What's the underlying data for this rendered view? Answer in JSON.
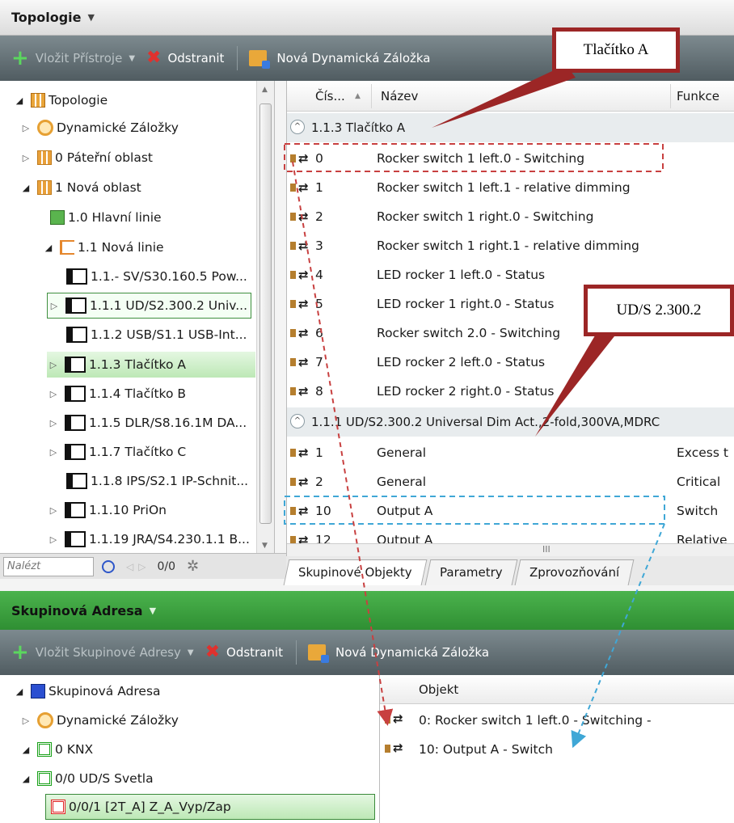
{
  "topology_panel": {
    "title": "Topologie",
    "toolbar": {
      "insert_devices": "Vložit Přístroje",
      "remove": "Odstranit",
      "new_dynamic_tab": "Nová Dynamická Záložka"
    },
    "tree": [
      {
        "label": "Topologie",
        "icon": "topology-icon",
        "expander": "open"
      },
      {
        "label": "Dynamické Záložky",
        "icon": "dynamic-folder-icon",
        "expander": "closed"
      },
      {
        "label": "0 Páteřní oblast",
        "icon": "area-icon",
        "expander": "closed"
      },
      {
        "label": "1 Nová oblast",
        "icon": "area-icon",
        "expander": "open"
      },
      {
        "label": "1.0 Hlavní linie",
        "icon": "main-line-icon",
        "expander": "none"
      },
      {
        "label": "1.1 Nová linie",
        "icon": "line-icon",
        "expander": "open"
      },
      {
        "label": "1.1.- SV/S30.160.5 Pow...",
        "icon": "device-icon",
        "expander": "none"
      },
      {
        "label": "1.1.1 UD/S2.300.2 Univ...",
        "icon": "device-icon",
        "expander": "closed"
      },
      {
        "label": "1.1.2 USB/S1.1 USB-Int...",
        "icon": "device-icon",
        "expander": "none"
      },
      {
        "label": "1.1.3 Tlačítko A",
        "icon": "device-icon",
        "expander": "closed"
      },
      {
        "label": "1.1.4 Tlačítko B",
        "icon": "device-icon",
        "expander": "closed"
      },
      {
        "label": "1.1.5 DLR/S8.16.1M DA...",
        "icon": "device-icon",
        "expander": "closed"
      },
      {
        "label": "1.1.7 Tlačítko C",
        "icon": "device-icon",
        "expander": "closed"
      },
      {
        "label": "1.1.8 IPS/S2.1 IP-Schnit...",
        "icon": "device-icon",
        "expander": "none"
      },
      {
        "label": "1.1.10 PriOn",
        "icon": "device-icon",
        "expander": "closed"
      },
      {
        "label": "1.1.19 JRA/S4.230.1.1 B...",
        "icon": "device-icon",
        "expander": "closed"
      }
    ],
    "search": {
      "placeholder": "Nalézt",
      "counter": "0/0"
    },
    "grid": {
      "columns": [
        "Čís...",
        "Název",
        "Funkce"
      ],
      "group1": "1.1.3  Tlačítko A",
      "rows1": [
        {
          "num": "0",
          "name": "Rocker switch 1 left.0 - Switching",
          "func": ""
        },
        {
          "num": "1",
          "name": "Rocker switch 1 left.1 - relative dimming",
          "func": ""
        },
        {
          "num": "2",
          "name": "Rocker switch 1 right.0 - Switching",
          "func": ""
        },
        {
          "num": "3",
          "name": "Rocker switch 1 right.1 - relative dimming",
          "func": ""
        },
        {
          "num": "4",
          "name": "LED rocker 1 left.0 - Status",
          "func": ""
        },
        {
          "num": "5",
          "name": "LED rocker 1 right.0 - Status",
          "func": ""
        },
        {
          "num": "6",
          "name": "Rocker switch 2.0 - Switching",
          "func": ""
        },
        {
          "num": "7",
          "name": "LED rocker 2 left.0 - Status",
          "func": ""
        },
        {
          "num": "8",
          "name": "LED rocker 2 right.0 - Status",
          "func": ""
        }
      ],
      "group2": "1.1.1  UD/S2.300.2 Universal Dim Act.,2-fold,300VA,MDRC",
      "rows2": [
        {
          "num": "1",
          "name": "General",
          "func": "Excess t"
        },
        {
          "num": "2",
          "name": "General",
          "func": "Critical"
        },
        {
          "num": "10",
          "name": "Output A",
          "func": "Switch"
        },
        {
          "num": "12",
          "name": "Output A",
          "func": "Relative"
        }
      ],
      "scroll_mark": "III"
    },
    "tabs": [
      "Skupinové Objekty",
      "Parametry",
      "Zprovozňování"
    ]
  },
  "group_address_panel": {
    "title": "Skupinová Adresa",
    "toolbar": {
      "insert_group_addresses": "Vložit Skupinové Adresy",
      "remove": "Odstranit",
      "new_dynamic_tab": "Nová Dynamická Záložka"
    },
    "tree": [
      {
        "label": "Skupinová Adresa",
        "icon": "group-address-icon",
        "expander": "open"
      },
      {
        "label": "Dynamické Záložky",
        "icon": "dynamic-folder-icon",
        "expander": "closed"
      },
      {
        "label": "0 KNX",
        "icon": "main-group-icon",
        "expander": "open"
      },
      {
        "label": "0/0 UD/S Svetla",
        "icon": "middle-group-icon",
        "expander": "open"
      },
      {
        "label": "0/0/1 [2T_A] Z_A_Vyp/Zap",
        "icon": "group-address-red-icon",
        "expander": "none"
      }
    ],
    "grid": {
      "column": "Objekt",
      "rows": [
        "0: Rocker switch 1 left.0 - Switching -",
        "10: Output A - Switch"
      ]
    }
  },
  "annotations": {
    "callout_a": "Tlačítko A",
    "callout_b": "UD/S 2.300.2",
    "colors": {
      "red": "#9c2626",
      "dashed_red": "#c84040",
      "dashed_blue": "#3fa7d6",
      "panel_green": "#3a9f3d"
    }
  }
}
